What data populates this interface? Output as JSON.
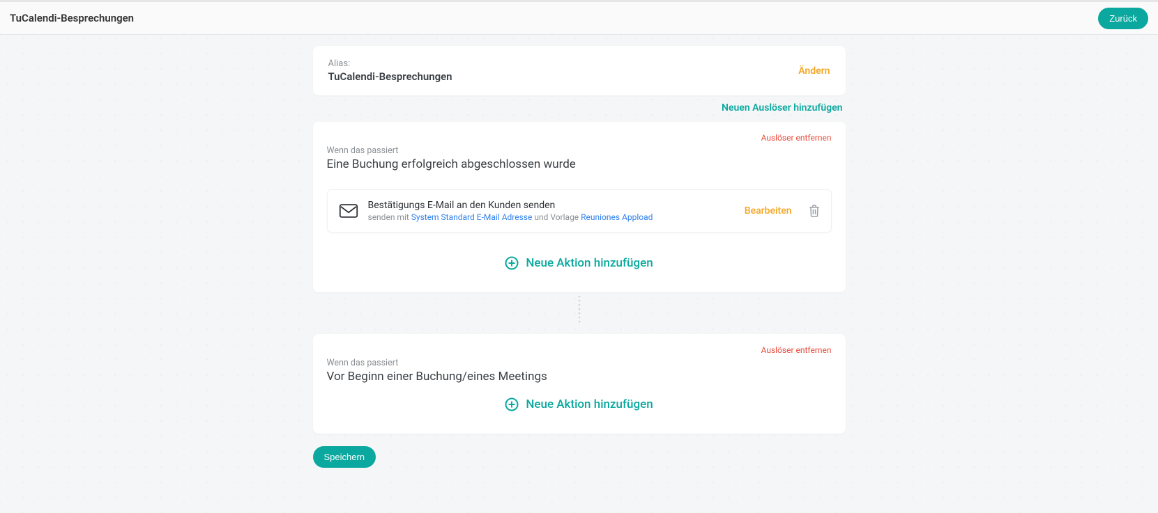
{
  "header": {
    "title": "TuCalendi-Besprechungen",
    "back": "Zurück"
  },
  "alias": {
    "label": "Alias:",
    "value": "TuCalendi-Besprechungen",
    "change": "Ändern"
  },
  "links": {
    "add_trigger": "Neuen Auslöser hinzufügen",
    "remove_trigger": "Auslöser entfernen",
    "add_action": "Neue Aktion hinzufügen"
  },
  "triggers": [
    {
      "when_label": "Wenn das passiert",
      "when_title": "Eine Buchung erfolgreich abgeschlossen wurde",
      "action": {
        "title": "Bestätigungs E-Mail an den Kunden senden",
        "sub_prefix": "senden mit ",
        "sub_link1": "System Standard E-Mail Adresse",
        "sub_mid": " und Vorlage ",
        "sub_link2": "Reuniones Appload",
        "edit": "Bearbeiten"
      }
    },
    {
      "when_label": "Wenn das passiert",
      "when_title": "Vor Beginn einer Buchung/eines Meetings"
    }
  ],
  "footer": {
    "save": "Speichern"
  }
}
